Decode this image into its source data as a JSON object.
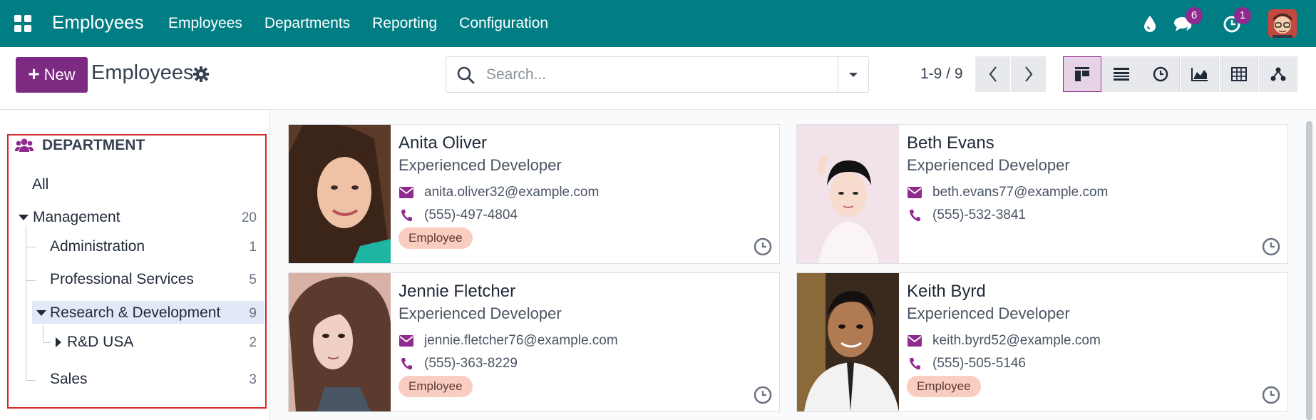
{
  "navbar": {
    "app_name": "Employees",
    "menu": [
      "Employees",
      "Departments",
      "Reporting",
      "Configuration"
    ],
    "messages_badge": "6",
    "activities_badge": "1",
    "color": "#017e84"
  },
  "control_panel": {
    "new_label": "New",
    "title": "Employees",
    "search_placeholder": "Search...",
    "pager": "1-9 / 9",
    "views": [
      "kanban-icon",
      "list-icon",
      "activity-icon",
      "graph-icon",
      "pivot-icon",
      "hierarchy-icon"
    ],
    "active_view": "kanban-icon"
  },
  "sidebar": {
    "header": "DEPARTMENT",
    "all_label": "All",
    "items": [
      {
        "label": "Management",
        "count": "20"
      },
      {
        "label": "Administration",
        "count": "1"
      },
      {
        "label": "Professional Services",
        "count": "5"
      },
      {
        "label": "Research & Development",
        "count": "9"
      },
      {
        "label": "R&D USA",
        "count": "2"
      },
      {
        "label": "Sales",
        "count": "3"
      }
    ]
  },
  "employees": [
    {
      "name": "Anita Oliver",
      "job": "Experienced Developer",
      "email": "anita.oliver32@example.com",
      "phone": "(555)-497-4804",
      "tag": "Employee"
    },
    {
      "name": "Beth Evans",
      "job": "Experienced Developer",
      "email": "beth.evans77@example.com",
      "phone": "(555)-532-3841",
      "tag": ""
    },
    {
      "name": "Jennie Fletcher",
      "job": "Experienced Developer",
      "email": "jennie.fletcher76@example.com",
      "phone": "(555)-363-8229",
      "tag": "Employee"
    },
    {
      "name": "Keith Byrd",
      "job": "Experienced Developer",
      "email": "keith.byrd52@example.com",
      "phone": "(555)-505-5146",
      "tag": "Employee"
    }
  ]
}
